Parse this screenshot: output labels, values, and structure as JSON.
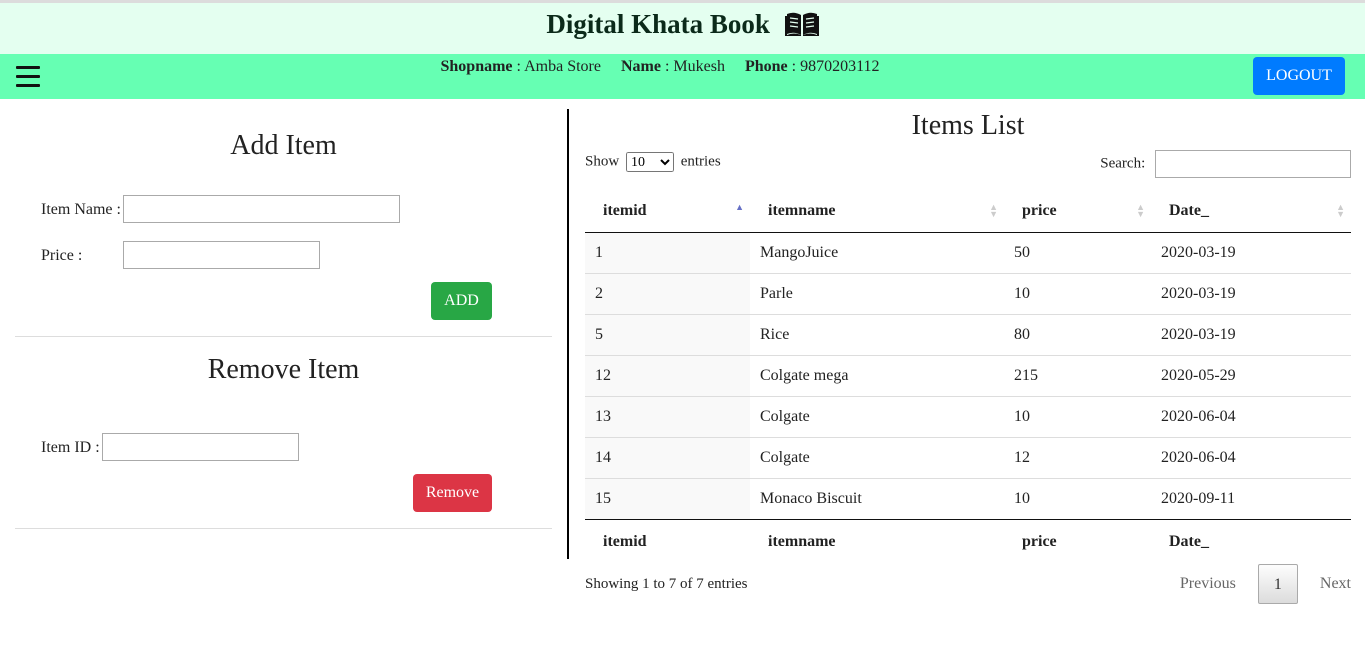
{
  "header": {
    "title": "Digital Khata Book",
    "icon": "open-book-icon"
  },
  "navbar": {
    "shopname_label": "Shopname",
    "shopname": "Amba Store",
    "name_label": "Name",
    "name": "Mukesh",
    "phone_label": "Phone",
    "phone": "9870203112",
    "logout_label": "LOGOUT",
    "accent": "#66ffb3"
  },
  "add_item": {
    "title": "Add Item",
    "item_name_label": "Item Name :",
    "item_name_value": "",
    "price_label": "Price :",
    "price_value": "",
    "add_label": "ADD",
    "add_color": "#28a745"
  },
  "remove_item": {
    "title": "Remove Item",
    "item_id_label": "Item ID :",
    "item_id_value": "",
    "remove_label": "Remove",
    "remove_color": "#dc3545"
  },
  "items_list": {
    "title": "Items List",
    "show_label": "Show",
    "entries_label": "entries",
    "entries_selected": "10",
    "search_label": "Search:",
    "search_value": "",
    "columns": [
      "itemid",
      "itemname",
      "price",
      "Date_"
    ],
    "rows": [
      {
        "itemid": "1",
        "itemname": "MangoJuice",
        "price": "50",
        "date": "2020-03-19"
      },
      {
        "itemid": "2",
        "itemname": "Parle",
        "price": "10",
        "date": "2020-03-19"
      },
      {
        "itemid": "5",
        "itemname": "Rice",
        "price": "80",
        "date": "2020-03-19"
      },
      {
        "itemid": "12",
        "itemname": "Colgate mega",
        "price": "215",
        "date": "2020-05-29"
      },
      {
        "itemid": "13",
        "itemname": "Colgate",
        "price": "10",
        "date": "2020-06-04"
      },
      {
        "itemid": "14",
        "itemname": "Colgate",
        "price": "12",
        "date": "2020-06-04"
      },
      {
        "itemid": "15",
        "itemname": "Monaco Biscuit",
        "price": "10",
        "date": "2020-09-11"
      }
    ],
    "info": "Showing 1 to 7 of 7 entries",
    "previous_label": "Previous",
    "current_page": "1",
    "next_label": "Next"
  }
}
